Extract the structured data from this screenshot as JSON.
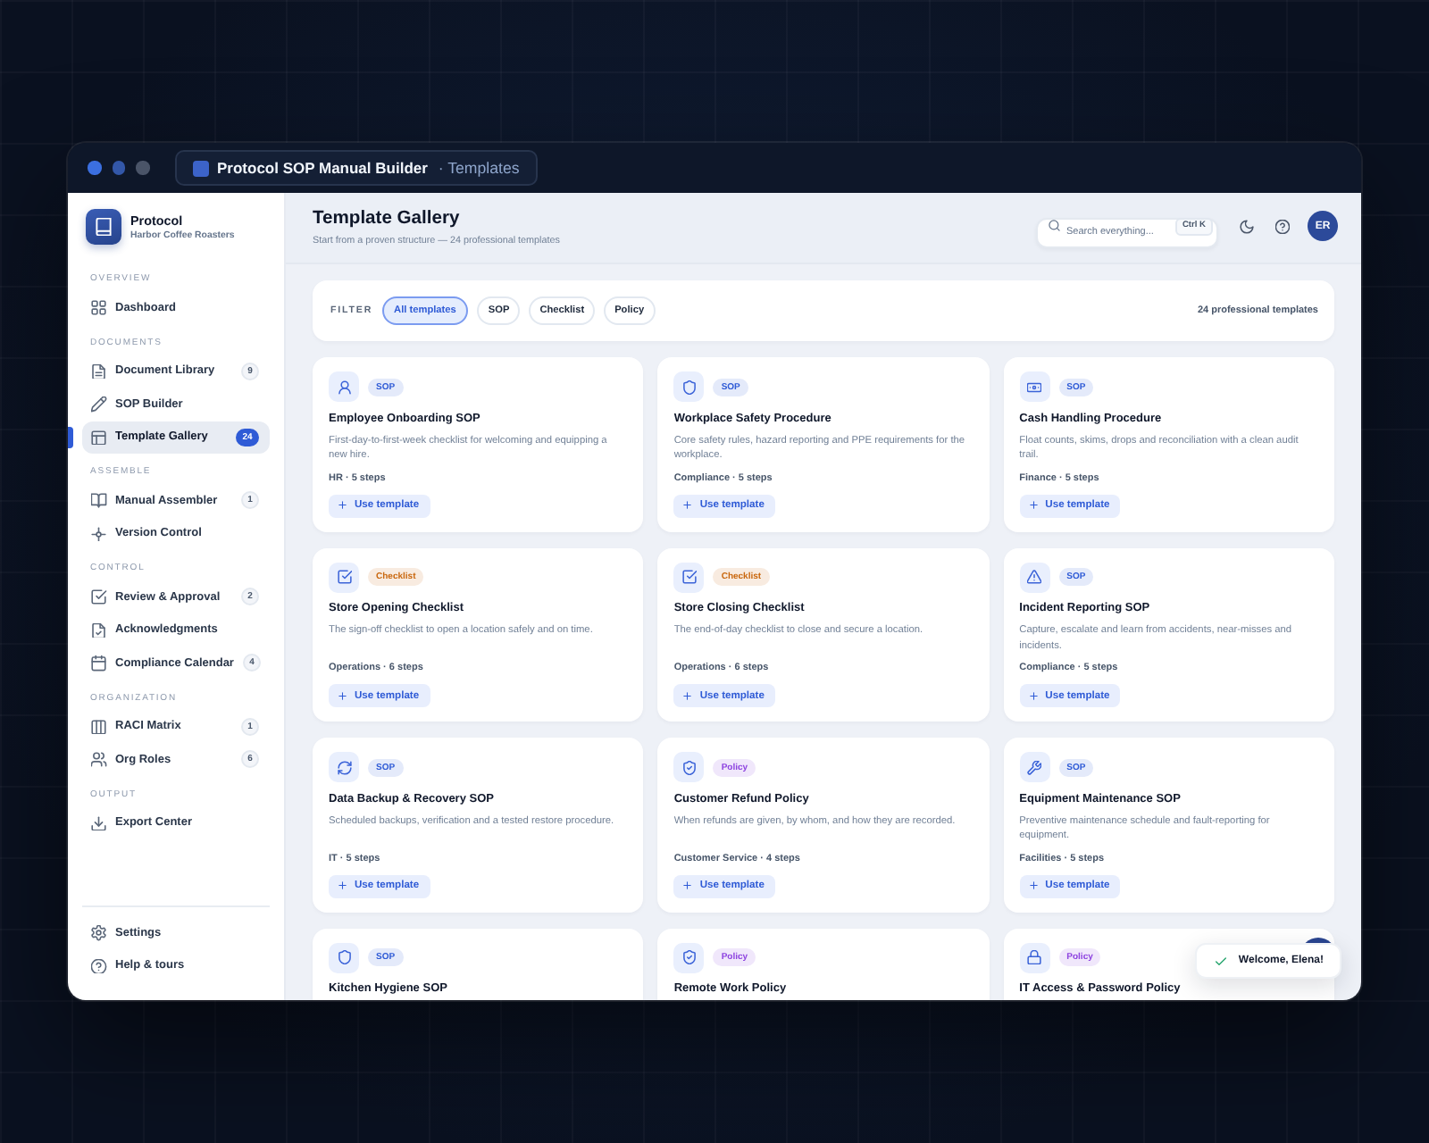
{
  "window": {
    "title": "Protocol SOP Manual Builder",
    "breadcrumb": "· Templates"
  },
  "sidebar": {
    "brand": {
      "name": "Protocol",
      "organization": "Harbor Coffee Roasters"
    },
    "sections": [
      {
        "label": "OVERVIEW",
        "items": [
          {
            "label": "Dashboard",
            "selected": false
          }
        ]
      },
      {
        "label": "DOCUMENTS",
        "items": [
          {
            "label": "Document Library",
            "count": "9",
            "selected": false
          },
          {
            "label": "SOP Builder",
            "selected": false
          },
          {
            "label": "Template Gallery",
            "count": "24",
            "selected": true
          }
        ]
      },
      {
        "label": "ASSEMBLE",
        "items": [
          {
            "label": "Manual Assembler",
            "count": "1",
            "selected": false
          },
          {
            "label": "Version Control",
            "selected": false
          }
        ]
      },
      {
        "label": "CONTROL",
        "items": [
          {
            "label": "Review & Approval",
            "count": "2",
            "selected": false
          },
          {
            "label": "Acknowledgments",
            "selected": false
          },
          {
            "label": "Compliance Calendar",
            "count": "4",
            "selected": false
          }
        ]
      },
      {
        "label": "ORGANIZATION",
        "items": [
          {
            "label": "RACI Matrix",
            "count": "1",
            "selected": false
          },
          {
            "label": "Org Roles",
            "count": "6",
            "selected": false
          }
        ]
      },
      {
        "label": "OUTPUT",
        "items": [
          {
            "label": "Export Center",
            "selected": false
          }
        ]
      }
    ],
    "footer_items": [
      {
        "label": "Settings",
        "selected": false
      },
      {
        "label": "Help & tours",
        "selected": false
      }
    ]
  },
  "header": {
    "title": "Template Gallery",
    "subtitle": "Start from a proven structure — 24 professional templates",
    "search": {
      "placeholder": "Search everything...",
      "shortcut": "Ctrl K"
    },
    "avatar": "ER"
  },
  "filter": {
    "label": "FILTER",
    "chips": [
      {
        "label": "All templates",
        "selected": true
      },
      {
        "label": "SOP",
        "selected": false
      },
      {
        "label": "Checklist",
        "selected": false
      },
      {
        "label": "Policy",
        "selected": false
      }
    ],
    "count": "24 professional templates"
  },
  "cards": [
    {
      "title": "Employee Onboarding SOP",
      "tag": {
        "label": "SOP",
        "color": "#2f5bd6"
      },
      "description": "First-day-to-first-week checklist for welcoming and equipping a new hire.",
      "meta": "HR · 5 steps",
      "action": "Use template"
    },
    {
      "title": "Workplace Safety Procedure",
      "tag": {
        "label": "SOP",
        "color": "#2f5bd6"
      },
      "description": "Core safety rules, hazard reporting and PPE requirements for the workplace.",
      "meta": "Compliance · 5 steps",
      "action": "Use template"
    },
    {
      "title": "Cash Handling Procedure",
      "tag": {
        "label": "SOP",
        "color": "#2f5bd6"
      },
      "description": "Float counts, skims, drops and reconciliation with a clean audit trail.",
      "meta": "Finance · 5 steps",
      "action": "Use template"
    },
    {
      "title": "Store Opening Checklist",
      "tag": {
        "label": "Checklist",
        "color": "#c9670e"
      },
      "description": "The sign-off checklist to open a location safely and on time.",
      "meta": "Operations · 6 steps",
      "action": "Use template"
    },
    {
      "title": "Store Closing Checklist",
      "tag": {
        "label": "Checklist",
        "color": "#c9670e"
      },
      "description": "The end-of-day checklist to close and secure a location.",
      "meta": "Operations · 6 steps",
      "action": "Use template"
    },
    {
      "title": "Incident Reporting SOP",
      "tag": {
        "label": "SOP",
        "color": "#2f5bd6"
      },
      "description": "Capture, escalate and learn from accidents, near-misses and incidents.",
      "meta": "Compliance · 5 steps",
      "action": "Use template"
    },
    {
      "title": "Data Backup & Recovery SOP",
      "tag": {
        "label": "SOP",
        "color": "#2f5bd6"
      },
      "description": "Scheduled backups, verification and a tested restore procedure.",
      "meta": "IT · 5 steps",
      "action": "Use template"
    },
    {
      "title": "Customer Refund Policy",
      "tag": {
        "label": "Policy",
        "color": "#8e44e0"
      },
      "description": "When refunds are given, by whom, and how they are recorded.",
      "meta": "Customer Service · 4 steps",
      "action": "Use template"
    },
    {
      "title": "Equipment Maintenance SOP",
      "tag": {
        "label": "SOP",
        "color": "#2f5bd6"
      },
      "description": "Preventive maintenance schedule and fault-reporting for equipment.",
      "meta": "Facilities · 5 steps",
      "action": "Use template"
    },
    {
      "title": "Kitchen Hygiene SOP",
      "tag": {
        "label": "SOP",
        "color": "#2f5bd6"
      }
    },
    {
      "title": "Remote Work Policy",
      "tag": {
        "label": "Policy",
        "color": "#8e44e0"
      }
    },
    {
      "title": "IT Access & Password Policy",
      "tag": {
        "label": "Policy",
        "color": "#8e44e0"
      }
    }
  ],
  "toast": {
    "message": "Welcome, Elena!"
  }
}
